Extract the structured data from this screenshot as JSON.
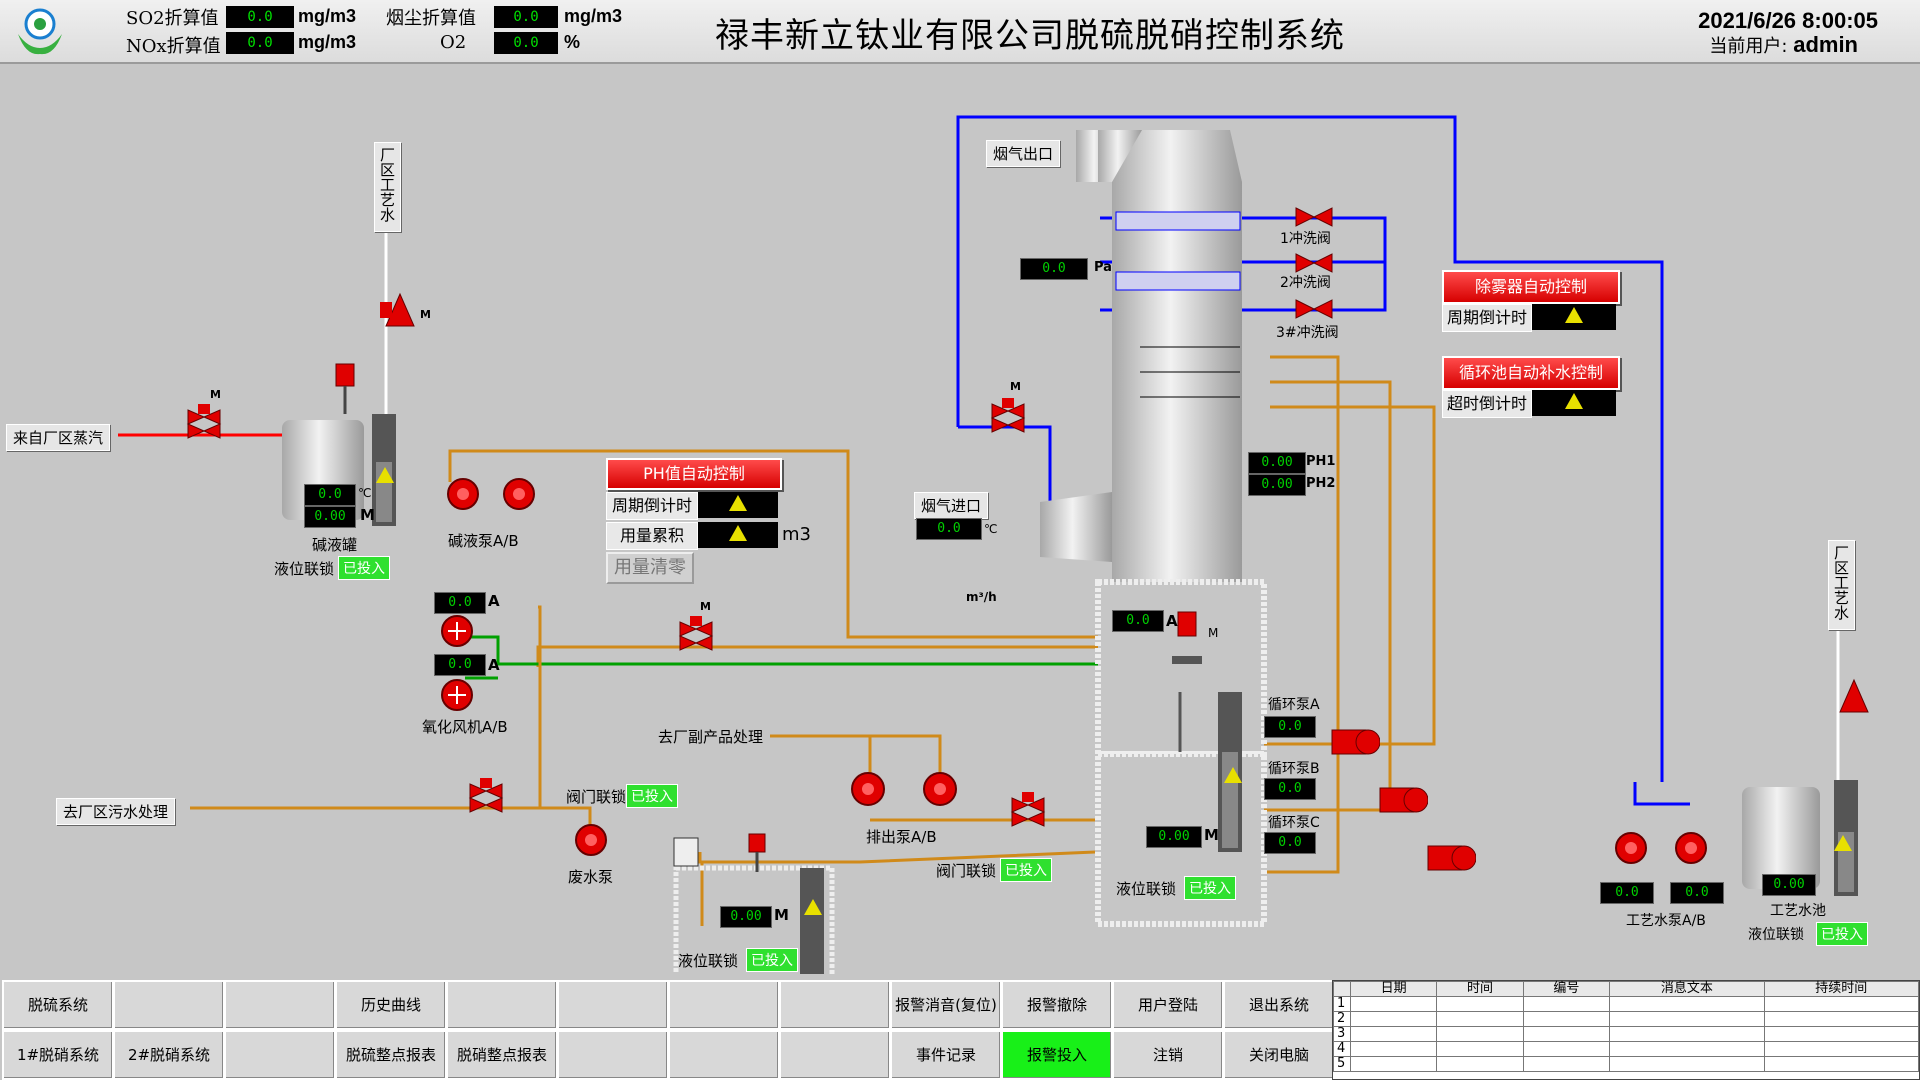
{
  "header": {
    "title": "禄丰新立钛业有限公司脱硫脱硝控制系统",
    "so2_label": "SO2折算值",
    "so2_value": "0.0",
    "so2_unit": "mg/m3",
    "nox_label": "NOx折算值",
    "nox_value": "0.0",
    "nox_unit": "mg/m3",
    "dust_label": "烟尘折算值",
    "dust_value": "0.0",
    "dust_unit": "mg/m3",
    "o2_label": "O2",
    "o2_value": "0.0",
    "o2_unit": "%",
    "datetime": "2021/6/26 8:00:05",
    "user_label": "当前用户:",
    "user": "admin"
  },
  "process": {
    "water_left": "厂区工艺水",
    "water_right": "厂区工艺水",
    "steam": "来自厂区蒸汽",
    "alkali_tank": "碱液罐",
    "alkali_temp": "0.0",
    "alkali_level": "0.00",
    "unit_c": "℃",
    "unit_m": "M",
    "unit_a": "A",
    "unit_pa": "Pa",
    "m_label": "M",
    "alkali_pump": "碱液泵A/B",
    "level_lock": "液位联锁",
    "engaged": "已投入",
    "ph_ctrl": "PH值自动控制",
    "cycle_countdown": "周期倒计时",
    "usage_total": "用量累积",
    "usage_unit": "m3",
    "usage_clear": "用量清零",
    "flue_out": "烟气出口",
    "flue_in": "烟气进口",
    "flue_in_temp": "0.0",
    "pressure": "0.0",
    "flow_unit": "m³/h",
    "wash1": "1冲洗阀",
    "wash2": "2冲洗阀",
    "wash3": "3#冲洗阀",
    "demister_ctrl": "除雾器自动控制",
    "demister_cycle": "周期倒计时",
    "refill_ctrl": "循环池自动补水控制",
    "overtime": "超时倒计时",
    "ph1_label": "PH1",
    "ph1": "0.00",
    "ph2_label": "PH2",
    "ph2": "0.00",
    "ox_current_a": "0.0",
    "ox_current_b": "0.0",
    "ox_fan": "氧化风机A/B",
    "agitator_current": "0.0",
    "byproduct": "去厂副产品处理",
    "sewage": "去厂区污水处理",
    "valve_lock": "阀门联锁",
    "waste_pump": "废水泵",
    "discharge_pump": "排出泵A/B",
    "pit_level": "0.00",
    "tower_level": "0.00",
    "circ_a": "循环泵A",
    "circ_a_val": "0.0",
    "circ_b": "循环泵B",
    "circ_b_val": "0.0",
    "circ_c": "循环泵C",
    "circ_c_val": "0.0",
    "process_pump": "工艺水泵A/B",
    "process_pump_a": "0.0",
    "process_pump_b": "0.0",
    "process_tank": "工艺水池",
    "process_tank_level": "0.00"
  },
  "nav": {
    "row1": [
      "脱硫系统",
      "",
      "",
      "历史曲线",
      "",
      "",
      "",
      "",
      "报警消音(复位)",
      "报警撤除",
      "用户登陆",
      "退出系统"
    ],
    "row2": [
      "1#脱硝系统",
      "2#脱硝系统",
      "",
      "脱硫整点报表",
      "脱硝整点报表",
      "",
      "",
      "",
      "事件记录",
      "报警投入",
      "注销",
      "关闭电脑"
    ]
  },
  "alarm_table": {
    "headers": [
      "日期",
      "时间",
      "编号",
      "消息文本",
      "持续时间"
    ],
    "rows": [
      "1",
      "2",
      "3",
      "4",
      "5"
    ]
  },
  "colors": {
    "pipe_orange": "#d08a1a",
    "pipe_blue": "#0000ff",
    "pipe_green": "#00a000",
    "pipe_red": "#ff0000",
    "equipment_red": "#e00000"
  }
}
